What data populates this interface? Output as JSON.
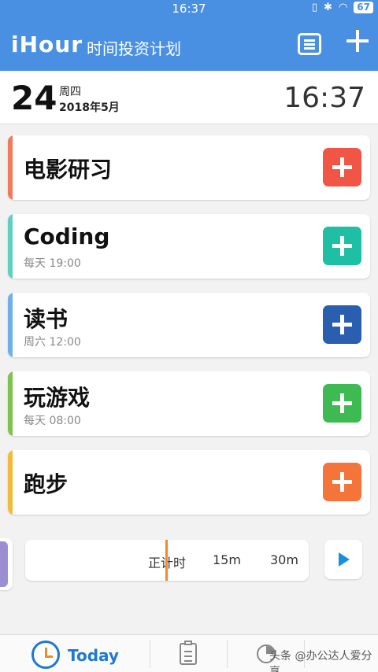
{
  "status": {
    "time": "16:37",
    "battery": "67"
  },
  "header": {
    "logo": "iHour",
    "subtitle": "时间投资计划"
  },
  "date": {
    "day": "24",
    "weekday": "周四",
    "month_year": "2018年5月",
    "clock": "16:37"
  },
  "tasks": [
    {
      "name": "电影研习",
      "schedule": "",
      "accent": "#f07a5a",
      "button": "#f05545"
    },
    {
      "name": "Coding",
      "schedule": "每天 19:00",
      "accent": "#5fd0c0",
      "button": "#1fbfa5"
    },
    {
      "name": "读书",
      "schedule": "周六 12:00",
      "accent": "#6fb0ea",
      "button": "#2a5fb0"
    },
    {
      "name": "玩游戏",
      "schedule": "每天 08:00",
      "accent": "#7cc44b",
      "button": "#3dbb52"
    },
    {
      "name": "跑步",
      "schedule": "",
      "accent": "#f5b93a",
      "button": "#f5743a"
    }
  ],
  "timer": {
    "mode": "正计时",
    "opt1": "15m",
    "opt2": "30m"
  },
  "bottom_nav": {
    "today": "Today"
  },
  "watermark": "头条 @办公达人爱分享"
}
